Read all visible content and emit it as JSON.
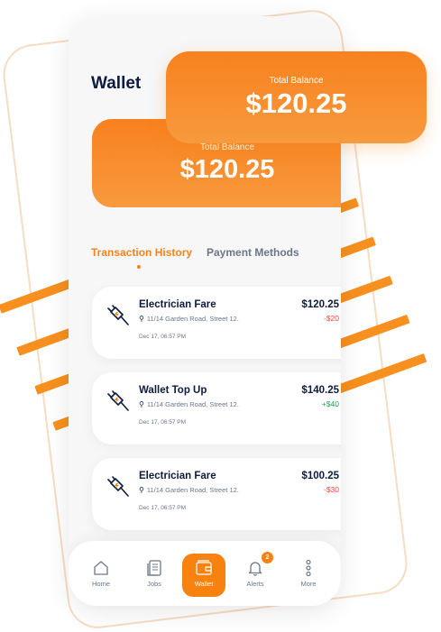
{
  "page": {
    "title": "Wallet"
  },
  "balance_front": {
    "label": "Total Balance",
    "amount": "$120.25"
  },
  "balance_back": {
    "label": "Total Balance",
    "amount": "$120.25"
  },
  "tabs": [
    {
      "label": "Transaction History",
      "active": true
    },
    {
      "label": "Payment Methods",
      "active": false
    }
  ],
  "transactions": [
    {
      "title": "Electrician Fare",
      "address": "11/14 Garden Road, Street 12.",
      "date": "Dec 17, 06:57 PM",
      "amount": "$120.25",
      "change": "-$20",
      "type": "debit",
      "icon": "electric-plug-icon"
    },
    {
      "title": "Wallet Top Up",
      "address": "11/14 Garden Road, Street 12.",
      "date": "Dec 17, 06:57 PM",
      "amount": "$140.25",
      "change": "+$40",
      "type": "credit",
      "icon": "electric-plug-icon"
    },
    {
      "title": "Electrician Fare",
      "address": "11/14 Garden Road, Street 12.",
      "date": "Dec 17, 06:57 PM",
      "amount": "$100.25",
      "change": "-$30",
      "type": "debit",
      "icon": "electric-plug-icon"
    }
  ],
  "nav": [
    {
      "label": "Home",
      "icon": "home-icon"
    },
    {
      "label": "Jobs",
      "icon": "jobs-icon"
    },
    {
      "label": "Wallet",
      "icon": "wallet-icon",
      "active": true
    },
    {
      "label": "Alerts",
      "icon": "bell-icon",
      "badge": "2"
    },
    {
      "label": "More",
      "icon": "more-icon"
    }
  ],
  "colors": {
    "accent": "#f7820f",
    "navy": "#0d1b3e",
    "negative": "#f04a3e",
    "positive": "#21a153"
  }
}
